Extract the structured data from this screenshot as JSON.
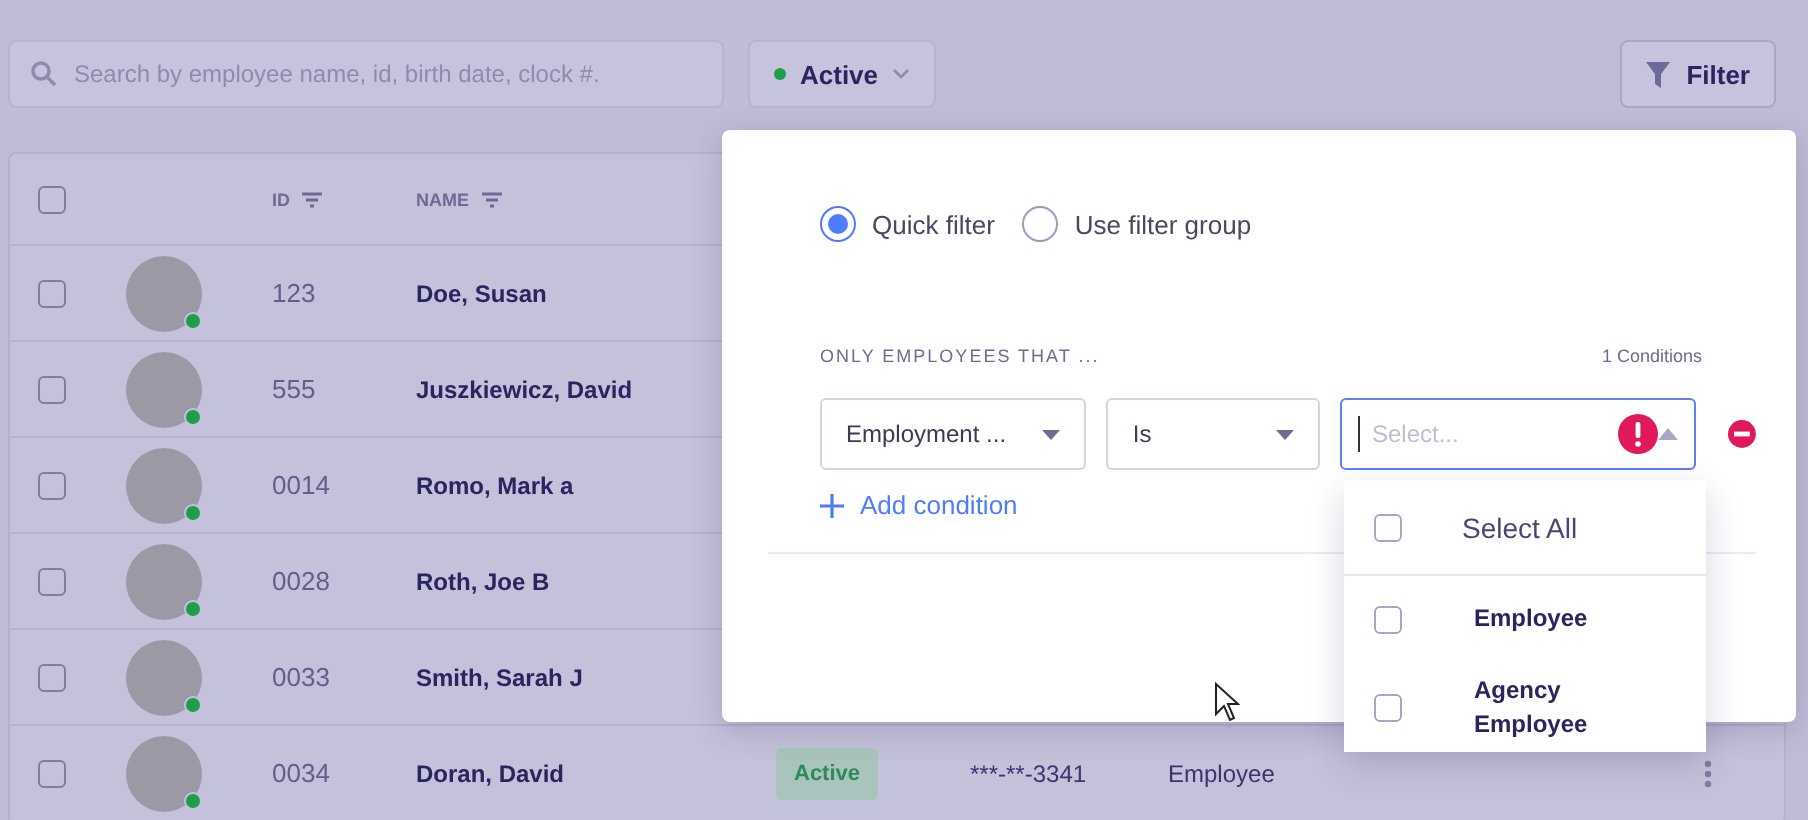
{
  "toolbar": {
    "search": {
      "placeholder": "Search by employee name, id, birth date, clock #."
    },
    "status_filter": {
      "label": "Active",
      "color": "#1e9e4a"
    },
    "filter_button": {
      "label": "Filter"
    }
  },
  "table": {
    "header_checkbox": {
      "checked": false
    },
    "columns": [
      {
        "label": "ID"
      },
      {
        "label": "NAME"
      }
    ],
    "rows": [
      {
        "checked": false,
        "online": true,
        "id": "123",
        "name": "Doe, Susan"
      },
      {
        "checked": false,
        "online": true,
        "id": "555",
        "name": "Juszkiewicz, David"
      },
      {
        "checked": false,
        "online": true,
        "id": "0014",
        "name": "Romo, Mark a"
      },
      {
        "checked": false,
        "online": true,
        "id": "0028",
        "name": "Roth, Joe B"
      },
      {
        "checked": false,
        "online": true,
        "id": "0033",
        "name": "Smith, Sarah J"
      },
      {
        "checked": false,
        "online": true,
        "id": "0034",
        "name": "Doran, David",
        "status": "Active",
        "ssn": "***-**-3341",
        "type": "Employee"
      }
    ]
  },
  "filter_popover": {
    "modes": [
      {
        "label": "Quick filter",
        "selected": true
      },
      {
        "label": "Use filter group",
        "selected": false
      }
    ],
    "section_label": "ONLY EMPLOYEES THAT ...",
    "condition_count": "1 Conditions",
    "condition": {
      "field": "Employment ...",
      "operator": "Is",
      "value": {
        "placeholder": "Select...",
        "error": true
      }
    },
    "add_condition": "Add condition",
    "options": [
      {
        "label": "Select All",
        "checked": false
      },
      {
        "label": "Employee",
        "checked": false
      },
      {
        "label": "Agency Employee",
        "checked": false
      }
    ]
  }
}
